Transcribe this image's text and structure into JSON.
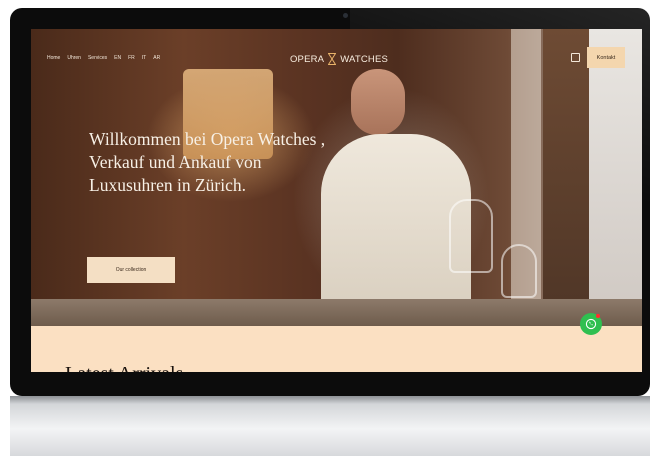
{
  "nav": {
    "items": [
      "Home",
      "Uhren",
      "Services",
      "EN",
      "FR",
      "IT",
      "AR"
    ]
  },
  "logo": {
    "left": "OPERA",
    "right": "WATCHES",
    "mark_icon": "hourglass-icon"
  },
  "header": {
    "utility_icon": "square-icon",
    "contact_label": "Kontakt"
  },
  "hero": {
    "headline": "Willkommen bei Opera Watches , Verkauf und Ankauf von Luxusuhren in Zürich.",
    "cta_label": "Our collection"
  },
  "section": {
    "title": "Latest Arrivals"
  },
  "whatsapp": {
    "icon": "whatsapp-icon"
  },
  "colors": {
    "accent": "#f4d6ae",
    "band": "#fbe0c2",
    "whatsapp": "#2fbf50"
  }
}
